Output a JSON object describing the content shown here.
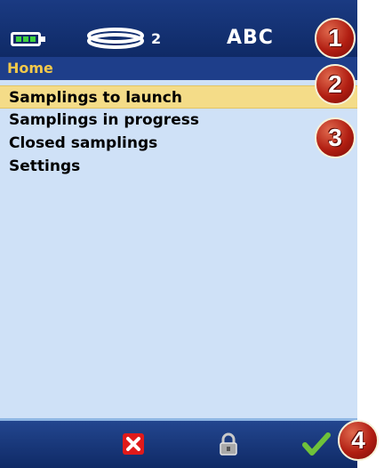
{
  "status": {
    "signal_count": "2",
    "input_mode": "ABC",
    "battery_color": "#3fd23f"
  },
  "title": "Home",
  "menu": [
    {
      "label": "Samplings to launch",
      "selected": true
    },
    {
      "label": "Samplings in progress",
      "selected": false
    },
    {
      "label": "Closed samplings",
      "selected": false
    },
    {
      "label": "Settings",
      "selected": false
    }
  ],
  "bottom_bar": {
    "icons": [
      "cancel-icon",
      "lock-icon",
      "confirm-icon"
    ]
  },
  "callouts": [
    "1",
    "2",
    "3",
    "4"
  ],
  "colors": {
    "background": "#0f2a66",
    "content": "#cfe1f7",
    "selection": "#f4dc88",
    "title_text": "#f2c84a",
    "callout": "#b11e12"
  }
}
